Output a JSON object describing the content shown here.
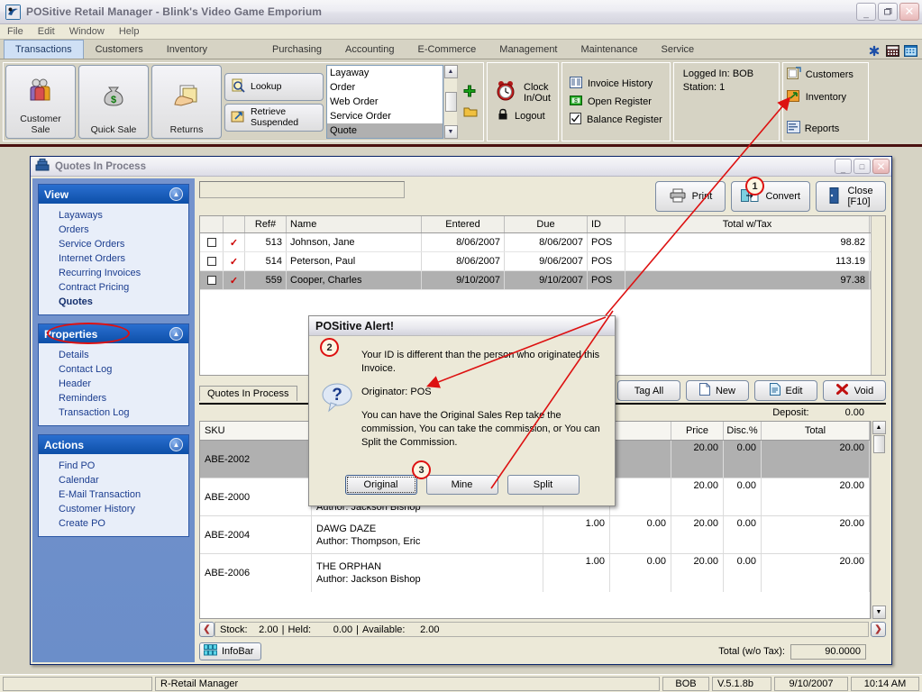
{
  "window": {
    "title": "POSitive Retail Manager - Blink's Video Game Emporium",
    "icon": "app-logo-icon",
    "minimize": "_",
    "maximize": "❐",
    "close": "✕"
  },
  "menubar": {
    "items": [
      "File",
      "Edit",
      "Window",
      "Help"
    ]
  },
  "ribbon": {
    "tabs": [
      {
        "label": "Transactions",
        "active": true
      },
      {
        "label": "Customers",
        "active": false
      },
      {
        "label": "Inventory",
        "active": false
      },
      {
        "label": "Purchasing",
        "active": false
      },
      {
        "label": "Accounting",
        "active": false
      },
      {
        "label": "E-Commerce",
        "active": false
      },
      {
        "label": "Management",
        "active": false
      },
      {
        "label": "Maintenance",
        "active": false
      },
      {
        "label": "Service",
        "active": false
      }
    ],
    "big_buttons": [
      {
        "label_line1": "Customer",
        "label_line2": "Sale",
        "icon": "two-people-icon"
      },
      {
        "label_line1": "Quick Sale",
        "label_line2": "",
        "icon": "money-bag-icon"
      },
      {
        "label_line1": "Returns",
        "label_line2": "",
        "icon": "return-hand-icon"
      }
    ],
    "small_buttons": [
      {
        "label_line1": "Lookup",
        "label_line2": "",
        "icon": "magnify-doc-icon"
      },
      {
        "label_line1": "Retrieve",
        "label_line2": "Suspended",
        "icon": "retrieve-icon"
      }
    ],
    "transaction_list": {
      "items": [
        "Layaway",
        "Order",
        "Web Order",
        "Service Order",
        "Quote"
      ],
      "selected": "Quote"
    },
    "add_icon": "green-plus-icon",
    "open_icon": "yellow-folder-icon",
    "clock_group": [
      {
        "label_line1": "Clock",
        "label_line2": "In/Out",
        "icon": "alarm-clock-icon"
      },
      {
        "label_line1": "Logout",
        "label_line2": "",
        "icon": "black-lock-icon"
      }
    ],
    "register_group": [
      {
        "label": "Invoice History",
        "icon": "invoice-history-icon"
      },
      {
        "label": "Open Register",
        "icon": "cash-register-icon"
      },
      {
        "label": "Balance Register",
        "icon": "checkbox-check-icon"
      }
    ],
    "login_info": {
      "logged_in_label": "Logged In:",
      "logged_in_value": "BOB",
      "station_label": "Station:",
      "station_value": "1"
    },
    "header_icons": [
      "blue-asterisk-icon",
      "calculator-icon",
      "calendar-icon"
    ],
    "right_panel": [
      {
        "label": "Customers",
        "icon": "customers-card-icon"
      },
      {
        "label": "Inventory",
        "icon": "inventory-arrow-icon"
      },
      {
        "label": "Reports",
        "icon": "reports-icon"
      }
    ]
  },
  "child_window": {
    "title": "Quotes In Process",
    "icon": "register-icon",
    "minimize": "_",
    "maximize": "□",
    "close": "✕"
  },
  "sidebar": {
    "groups": [
      {
        "title": "View",
        "collapse_icon": "chevron-up-icon",
        "items": [
          {
            "label": "Layaways",
            "current": false
          },
          {
            "label": "Orders",
            "current": false
          },
          {
            "label": "Service Orders",
            "current": false
          },
          {
            "label": "Internet Orders",
            "current": false
          },
          {
            "label": "Recurring Invoices",
            "current": false
          },
          {
            "label": "Contract Pricing",
            "current": false
          },
          {
            "label": "Quotes",
            "current": true
          }
        ]
      },
      {
        "title": "Properties",
        "collapse_icon": "chevron-up-icon",
        "items": [
          {
            "label": "Details",
            "current": false
          },
          {
            "label": "Contact Log",
            "current": false
          },
          {
            "label": "Header",
            "current": false
          },
          {
            "label": "Reminders",
            "current": false
          },
          {
            "label": "Transaction Log",
            "current": false
          }
        ]
      },
      {
        "title": "Actions",
        "collapse_icon": "chevron-up-icon",
        "items": [
          {
            "label": "Find PO",
            "current": false
          },
          {
            "label": "Calendar",
            "current": false
          },
          {
            "label": "E-Mail Transaction",
            "current": false
          },
          {
            "label": "Customer History",
            "current": false
          },
          {
            "label": "Create PO",
            "current": false
          }
        ]
      }
    ]
  },
  "content": {
    "search_value": "",
    "search_placeholder": "",
    "top_buttons": [
      {
        "label": "Print",
        "line2": "",
        "icon": "printer-icon"
      },
      {
        "label": "Convert",
        "line2": "",
        "icon": "convert-icon"
      },
      {
        "label": "Close",
        "line2": "[F10]",
        "icon": "exit-door-icon"
      }
    ],
    "quotes_grid": {
      "columns": [
        "",
        "",
        "Ref#",
        "Name",
        "Entered",
        "Due",
        "ID",
        "Total w/Tax"
      ],
      "rows": [
        {
          "checked": false,
          "tick": "✓",
          "ref": "513",
          "name": "Johnson, Jane",
          "entered": "8/06/2007",
          "due": "8/06/2007",
          "id": "POS",
          "total": "98.82",
          "selected": false
        },
        {
          "checked": false,
          "tick": "✓",
          "ref": "514",
          "name": "Peterson, Paul",
          "entered": "8/06/2007",
          "due": "9/06/2007",
          "id": "POS",
          "total": "113.19",
          "selected": false
        },
        {
          "checked": false,
          "tick": "✓",
          "ref": "559",
          "name": "Cooper, Charles",
          "entered": "9/10/2007",
          "due": "9/10/2007",
          "id": "POS",
          "total": "97.38",
          "selected": true
        }
      ]
    },
    "tab_label": "Quotes In Process",
    "action_buttons": [
      {
        "label": "Tag All",
        "icon": ""
      },
      {
        "label": "New",
        "icon": "new-doc-icon"
      },
      {
        "label": "Edit",
        "icon": "edit-doc-icon"
      },
      {
        "label": "Void",
        "icon": "void-x-icon"
      }
    ],
    "deposit_label": "Deposit:",
    "deposit_value": "0.00",
    "detail_grid": {
      "columns": [
        "SKU",
        "",
        "",
        "",
        "Price",
        "Disc.%",
        "Total"
      ],
      "rows": [
        {
          "sku": "ABE-2002",
          "desc": "",
          "author": "",
          "qty": "",
          "x": "",
          "price": "20.00",
          "disc": "0.00",
          "total": "20.00",
          "selected": true
        },
        {
          "sku": "ABE-2000",
          "desc": "",
          "author": "Author: Jackson Bishop",
          "qty": "",
          "x": "",
          "price": "20.00",
          "disc": "0.00",
          "total": "20.00",
          "selected": false
        },
        {
          "sku": "ABE-2004",
          "desc": "DAWG DAZE",
          "author": "Author: Thompson, Eric",
          "qty": "1.00",
          "x": "0.00",
          "price": "20.00",
          "disc": "0.00",
          "total": "20.00",
          "selected": false
        },
        {
          "sku": "ABE-2006",
          "desc": "THE ORPHAN",
          "author": "Author: Jackson Bishop",
          "qty": "1.00",
          "x": "0.00",
          "price": "20.00",
          "disc": "0.00",
          "total": "20.00",
          "selected": false
        }
      ]
    },
    "stock_bar": {
      "prev_icon": "❮",
      "next_icon": "❯",
      "stock_label": "Stock:",
      "stock_value": "2.00",
      "held_label": "Held:",
      "held_value": "0.00",
      "available_label": "Available:",
      "available_value": "2.00"
    },
    "infobar_label": "InfoBar",
    "infobar_icon": "grid-squares-icon",
    "total_label": "Total (w/o Tax):",
    "total_value": "90.0000"
  },
  "alert": {
    "title": "POSitive Alert!",
    "icon": "question-bubble-icon",
    "line1": "Your ID is different than the person who originated this Invoice.",
    "line2": "Originator: POS",
    "line3": "You can have the Original Sales Rep take the commission, You can take the commission, or You can Split the Commission.",
    "buttons": [
      {
        "label": "Original",
        "focused": true
      },
      {
        "label": "Mine",
        "focused": false
      },
      {
        "label": "Split",
        "focused": false
      }
    ]
  },
  "statusbar": {
    "left": "",
    "app": "R-Retail Manager",
    "user": "BOB",
    "version": "V.5.1.8b",
    "date": "9/10/2007",
    "time": "10:14 AM"
  },
  "annotations": {
    "markers": [
      {
        "number": "1"
      },
      {
        "number": "2"
      },
      {
        "number": "3"
      }
    ],
    "highlight_color": "#dd1111"
  }
}
